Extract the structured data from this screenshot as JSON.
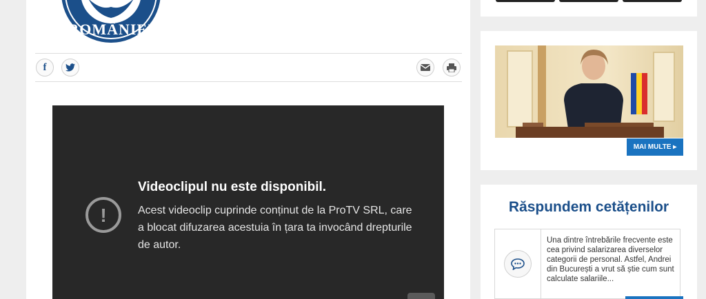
{
  "logo": {
    "text": "ROMÂNIEI",
    "colors": {
      "primary": "#1b4f8a"
    }
  },
  "share": {
    "icons": [
      "facebook-icon",
      "twitter-icon",
      "email-icon",
      "print-icon"
    ],
    "facebook_glyph": "f"
  },
  "video": {
    "title": "Videoclipul nu este disponibil.",
    "message": "Acest videoclip cuprinde conținut de la ProTV SRL, care a blocat difuzarea acestuia în țara ta invocând drepturile de autor.",
    "alert_glyph": "!"
  },
  "sidebar": {
    "photo_card": {
      "more_label": "MAI MULTE ▸"
    },
    "responses": {
      "title": "Răspundem cetățenilor",
      "excerpt": "Una dintre întrebările frecvente este cea privind salarizarea diverselor categorii de personal. Astfel, Andrei din București a vrut să știe cum sunt calculate salariile..."
    }
  },
  "colors": {
    "accent": "#1a73c0",
    "video_bg": "#282828",
    "title_blue": "#1b4f8a"
  }
}
